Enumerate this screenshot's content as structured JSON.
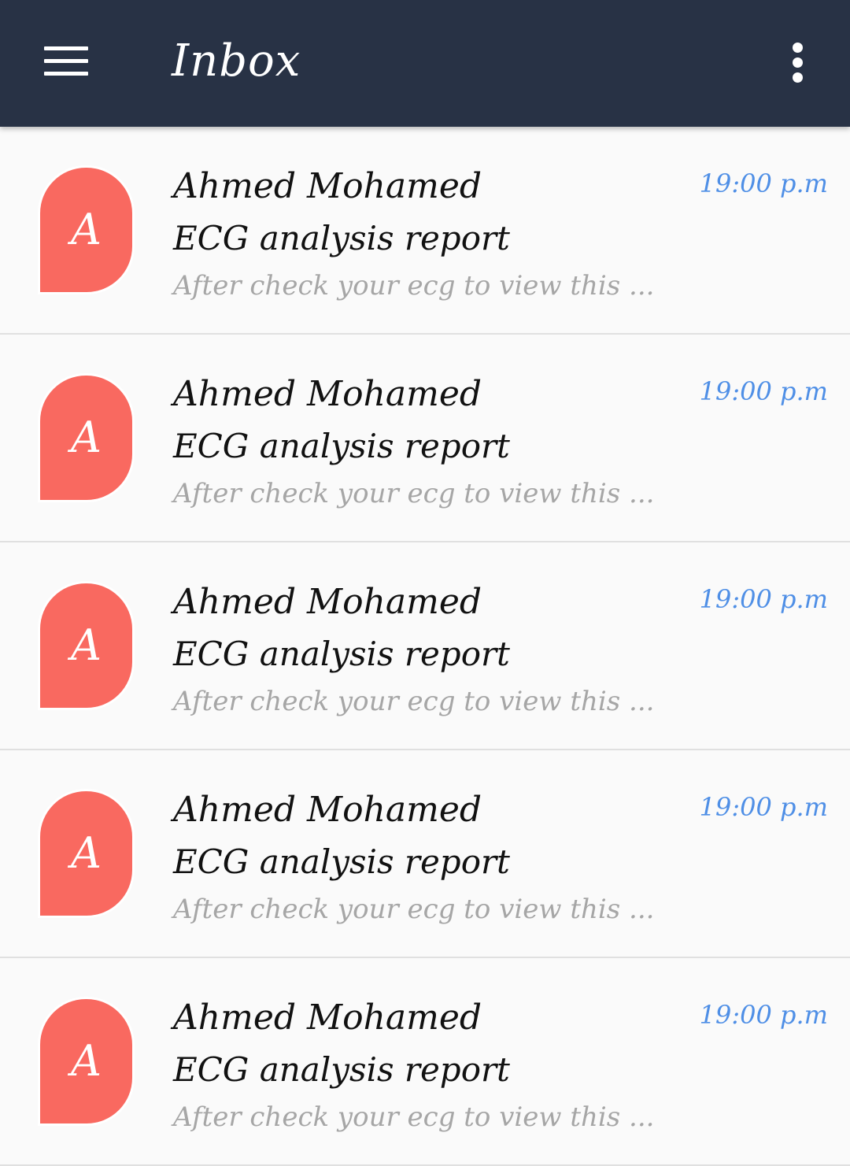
{
  "appbar": {
    "title": "Inbox",
    "menu_icon": "hamburger-menu-icon",
    "overflow_icon": "more-vertical-icon",
    "background_color": "#283245"
  },
  "accent": {
    "avatar_color": "#f96960",
    "time_color": "#4f8fe6",
    "preview_color": "#a6a6a6"
  },
  "messages": [
    {
      "avatar_letter": "A",
      "sender": "Ahmed Mohamed",
      "subject": "ECG analysis report",
      "preview": "After check your ecg to view this ...",
      "time": "19:00 p.m"
    },
    {
      "avatar_letter": "A",
      "sender": "Ahmed Mohamed",
      "subject": "ECG analysis report",
      "preview": "After check your ecg to view this ...",
      "time": "19:00 p.m"
    },
    {
      "avatar_letter": "A",
      "sender": "Ahmed Mohamed",
      "subject": "ECG analysis report",
      "preview": "After check your ecg to view this ...",
      "time": "19:00 p.m"
    },
    {
      "avatar_letter": "A",
      "sender": "Ahmed Mohamed",
      "subject": "ECG analysis report",
      "preview": "After check your ecg to view this ...",
      "time": "19:00 p.m"
    },
    {
      "avatar_letter": "A",
      "sender": "Ahmed Mohamed",
      "subject": "ECG analysis report",
      "preview": "After check your ecg to view this ...",
      "time": "19:00 p.m"
    }
  ]
}
